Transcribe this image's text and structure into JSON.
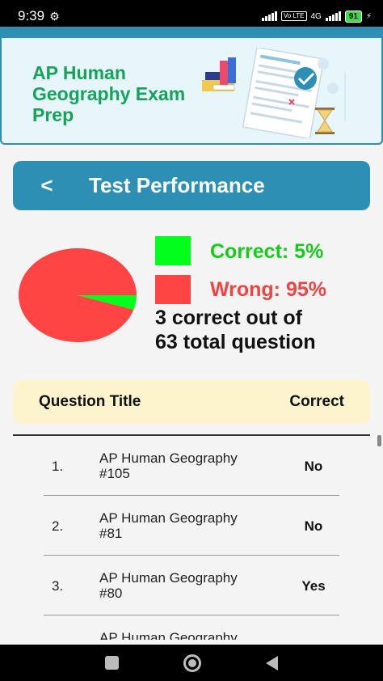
{
  "status_bar": {
    "time": "9:39",
    "network_label": "4G",
    "volte_label": "Vo LTE",
    "battery": "91"
  },
  "banner": {
    "title": "AP Human Geography Exam Prep",
    "title_color": "#15a35a"
  },
  "header": {
    "title": "Test Performance",
    "color": "#2e8fb5"
  },
  "chart_data": {
    "type": "pie",
    "slices": [
      {
        "name": "Correct",
        "value": 5,
        "color": "#00ff1a"
      },
      {
        "name": "Wrong",
        "value": 95,
        "color": "#ff4444"
      }
    ]
  },
  "legend": {
    "correct_label": "Correct: 5%",
    "wrong_label": "Wrong: 95%"
  },
  "summary": {
    "line1": "3 correct out of",
    "line2": "63 total question"
  },
  "table": {
    "col_title": "Question Title",
    "col_correct": "Correct",
    "rows": [
      {
        "num": "1.",
        "title_line1": "AP Human Geography",
        "title_line2": "#105",
        "correct": "No"
      },
      {
        "num": "2.",
        "title_line1": "AP Human Geography",
        "title_line2": "#81",
        "correct": "No"
      },
      {
        "num": "3.",
        "title_line1": "AP Human Geography",
        "title_line2": "#80",
        "correct": "Yes"
      },
      {
        "num": "",
        "title_line1": "AP Human Geography",
        "title_line2": "",
        "correct": ""
      }
    ]
  },
  "icons": {
    "back": "chevron-left-icon",
    "settings": "gear-icon"
  }
}
